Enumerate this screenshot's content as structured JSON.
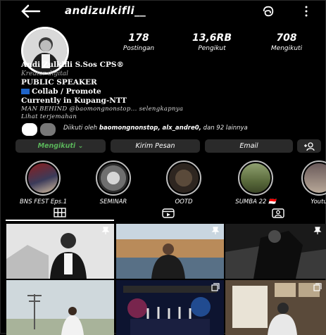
{
  "header": {
    "username": "andizulkifli__",
    "back_icon": "arrow-left-icon",
    "threads_icon": "threads-icon",
    "menu_icon": "more-vertical-icon"
  },
  "stats": {
    "posts": {
      "value": "178",
      "label": "Postingan"
    },
    "followers": {
      "value": "13,6RB",
      "label": "Pengikut"
    },
    "following": {
      "value": "708",
      "label": "Mengikuti"
    }
  },
  "bio": {
    "name": "Andi Zulkifli S.Sos CPS®",
    "category": "Kreator digital",
    "line1": "PUBLIC SPEAKER",
    "line2": "Collab / Promote",
    "line3": "Currently in Kupang-NTT",
    "line4": "MAN BEHIND @baomongnonstop... selengkapnya",
    "translate": "Lihat terjemahan"
  },
  "followed_by": {
    "prefix": "Diikuti oleh ",
    "names": "baomongnonstop, alx_andre0,",
    "suffix": " dan 92 lainnya"
  },
  "buttons": {
    "follow": "Mengikuti ⌄",
    "message": "Kirim Pesan",
    "email": "Email",
    "add_icon": "add-person-icon"
  },
  "highlights": [
    {
      "label": "BNS FEST Eps.1"
    },
    {
      "label": "SEMINAR"
    },
    {
      "label": "OOTD"
    },
    {
      "label": "SUMBA 22 🇮🇩"
    },
    {
      "label": "Youtu"
    }
  ],
  "tabs": [
    {
      "icon": "grid-icon"
    },
    {
      "icon": "reels-icon"
    },
    {
      "icon": "tagged-icon"
    }
  ],
  "colors": {
    "background": "#000000",
    "button": "#2a2a2a",
    "following_green": "#5ab55a"
  }
}
